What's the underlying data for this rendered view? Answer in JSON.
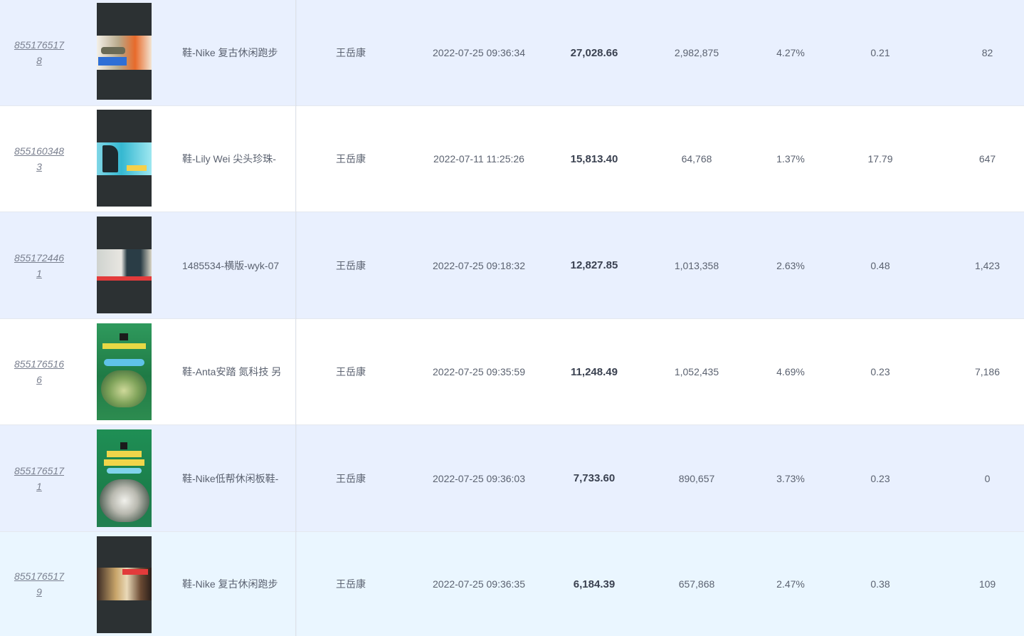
{
  "rows": [
    {
      "id_line1": "855176517",
      "id_line2": "8",
      "thumb": "nike-retro-sneaker-thumbnail",
      "title": "鞋-Nike 复古休闲跑步",
      "owner": "王岳康",
      "time": "2022-07-25 09:36:34",
      "revenue": "27,028.66",
      "views": "2,982,875",
      "rate": "4.27%",
      "ratio": "0.21",
      "count": "82"
    },
    {
      "id_line1": "855160348",
      "id_line2": "3",
      "thumb": "lily-wei-heels-thumbnail",
      "title": "鞋-Lily Wei 尖头珍珠-",
      "owner": "王岳康",
      "time": "2022-07-11 11:25:26",
      "revenue": "15,813.40",
      "views": "64,768",
      "rate": "1.37%",
      "ratio": "17.79",
      "count": "647"
    },
    {
      "id_line1": "855172446",
      "id_line2": "1",
      "thumb": "horizontal-product-thumbnail",
      "title": "1485534-横版-wyk-07",
      "owner": "王岳康",
      "time": "2022-07-25 09:18:32",
      "revenue": "12,827.85",
      "views": "1,013,358",
      "rate": "2.63%",
      "ratio": "0.48",
      "count": "1,423"
    },
    {
      "id_line1": "855176516",
      "id_line2": "6",
      "thumb": "anta-green-sneaker-thumbnail",
      "title": "鞋-Anta安踏 氮科技 另",
      "owner": "王岳康",
      "time": "2022-07-25 09:35:59",
      "revenue": "11,248.49",
      "views": "1,052,435",
      "rate": "4.69%",
      "ratio": "0.23",
      "count": "7,186"
    },
    {
      "id_line1": "855176517",
      "id_line2": "1",
      "thumb": "nike-low-board-shoe-thumbnail",
      "title": "鞋-Nike低帮休闲板鞋-",
      "owner": "王岳康",
      "time": "2022-07-25 09:36:03",
      "revenue": "7,733.60",
      "views": "890,657",
      "rate": "3.73%",
      "ratio": "0.23",
      "count": "0"
    },
    {
      "id_line1": "855176517",
      "id_line2": "9",
      "thumb": "nike-retro-runner-thumbnail",
      "title": "鞋-Nike 复古休闲跑步",
      "owner": "王岳康",
      "time": "2022-07-25 09:36:35",
      "revenue": "6,184.39",
      "views": "657,868",
      "rate": "2.47%",
      "ratio": "0.38",
      "count": "109"
    }
  ],
  "colors": {
    "accent": "#2b7fe3",
    "row_odd": "#e9f0fe",
    "row_hover": "#eaf6ff"
  }
}
